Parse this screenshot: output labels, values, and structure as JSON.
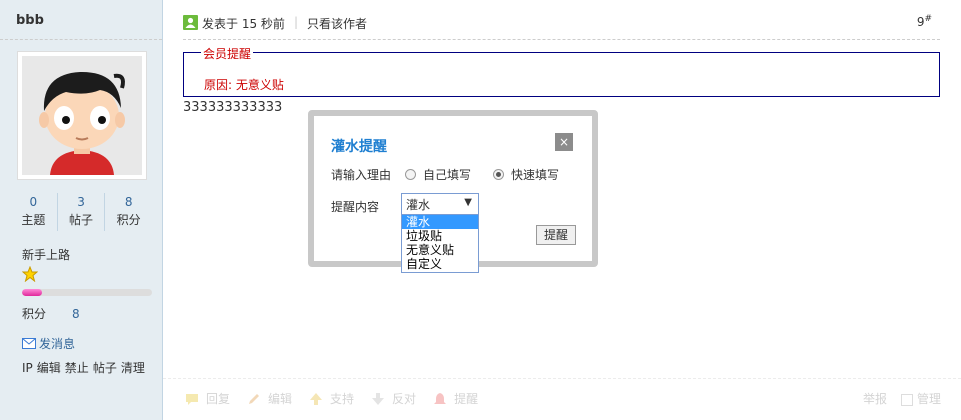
{
  "user": {
    "name": "bbb",
    "stats": [
      {
        "value": "0",
        "label": "主题"
      },
      {
        "value": "3",
        "label": "帖子"
      },
      {
        "value": "8",
        "label": "积分"
      }
    ],
    "rank": "新手上路",
    "progress": 0.15,
    "points_label": "积分",
    "points_value": "8",
    "send_message": "发消息",
    "admin_links": [
      "IP",
      "编辑",
      "禁止",
      "帖子",
      "清理"
    ]
  },
  "post": {
    "posted_label": "发表于 15 秒前",
    "separator": "|",
    "only_author": "只看该作者",
    "floor": "9",
    "floor_sup": "#",
    "notice_title": "会员提醒",
    "notice_reason": "原因: 无意义贴",
    "body": "333333333333"
  },
  "dialog": {
    "title": "灌水提醒",
    "close": "×",
    "reason_label": "请输入理由",
    "option_custom": "自己填写",
    "option_quick": "快速填写",
    "content_label": "提醒内容",
    "selected": "灌水",
    "submit": "提醒",
    "options": [
      "灌水",
      "垃圾贴",
      "无意义贴",
      "自定义"
    ]
  },
  "footer": {
    "reply": "回复",
    "edit": "编辑",
    "support": "支持",
    "oppose": "反对",
    "remind": "提醒",
    "report": "举报",
    "manage": "管理"
  }
}
